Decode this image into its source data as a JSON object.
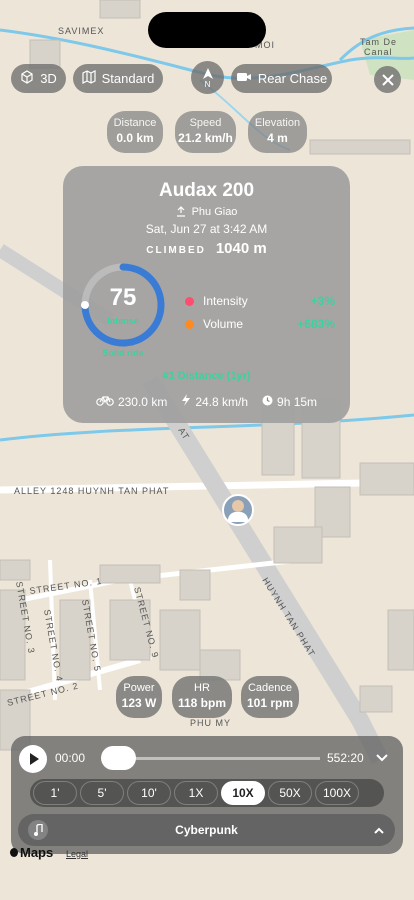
{
  "map": {
    "labels": {
      "top_left": "SAVIMEX",
      "top_center": "TAN THUAN",
      "top_right_area": "GO 3 MOI",
      "canal": "Tam De Canal",
      "alley": "ALLEY 1248 HUYNH TAN PHAT",
      "road_main": "HUYNH TAN PHAT",
      "street_1": "STREET NO. 1",
      "street_3": "STREET NO. 3",
      "street_4": "STREET NO. 4",
      "street_5": "STREET NO. 5",
      "street_9": "STREET NO. 9",
      "street_2": "STREET NO. 2",
      "street_bottom": "STREET NO. 1",
      "district": "PHU MY",
      "road_at": "AT"
    }
  },
  "controls": {
    "btn_3d": "3D",
    "btn_standard": "Standard",
    "compass": "N",
    "btn_rear_chase": "Rear Chase"
  },
  "stats": [
    {
      "label": "Distance",
      "value": "0.0 km"
    },
    {
      "label": "Speed",
      "value": "21.2 km/h"
    },
    {
      "label": "Elevation",
      "value": "4 m"
    }
  ],
  "card": {
    "title": "Audax 200",
    "location": "Phu Giao",
    "date": "Sat, Jun 27 at 3:42 AM",
    "climbed_label": "CLIMBED",
    "climbed_value": "1040 m",
    "score": "75",
    "score_label": "Intense",
    "score_note": "Solid ride",
    "score_fraction": 0.75,
    "metrics": [
      {
        "label": "Intensity",
        "value": "+3%",
        "color": "#ff4d6d"
      },
      {
        "label": "Volume",
        "value": "+683%",
        "color": "#ff8a1f"
      }
    ],
    "rank": "#1 Distance (1yr)",
    "summary": {
      "distance": "230.0 km",
      "avg_speed": "24.8 km/h",
      "duration": "9h 15m"
    }
  },
  "live": [
    {
      "label": "Power",
      "value": "123 W"
    },
    {
      "label": "HR",
      "value": "118 bpm"
    },
    {
      "label": "Cadence",
      "value": "101 rpm"
    }
  ],
  "playback": {
    "current_time": "00:00",
    "total_time": "552:20",
    "progress": 0.0,
    "speeds": [
      "1'",
      "5'",
      "10'",
      "1X",
      "10X",
      "50X",
      "100X"
    ],
    "active_speed": "10X"
  },
  "music": {
    "track": "Cyberpunk"
  },
  "footer": {
    "brand": "Maps",
    "legal": "Legal"
  },
  "colors": {
    "accent_green": "#3ad29f",
    "ring_blue": "#3a7bd5"
  }
}
